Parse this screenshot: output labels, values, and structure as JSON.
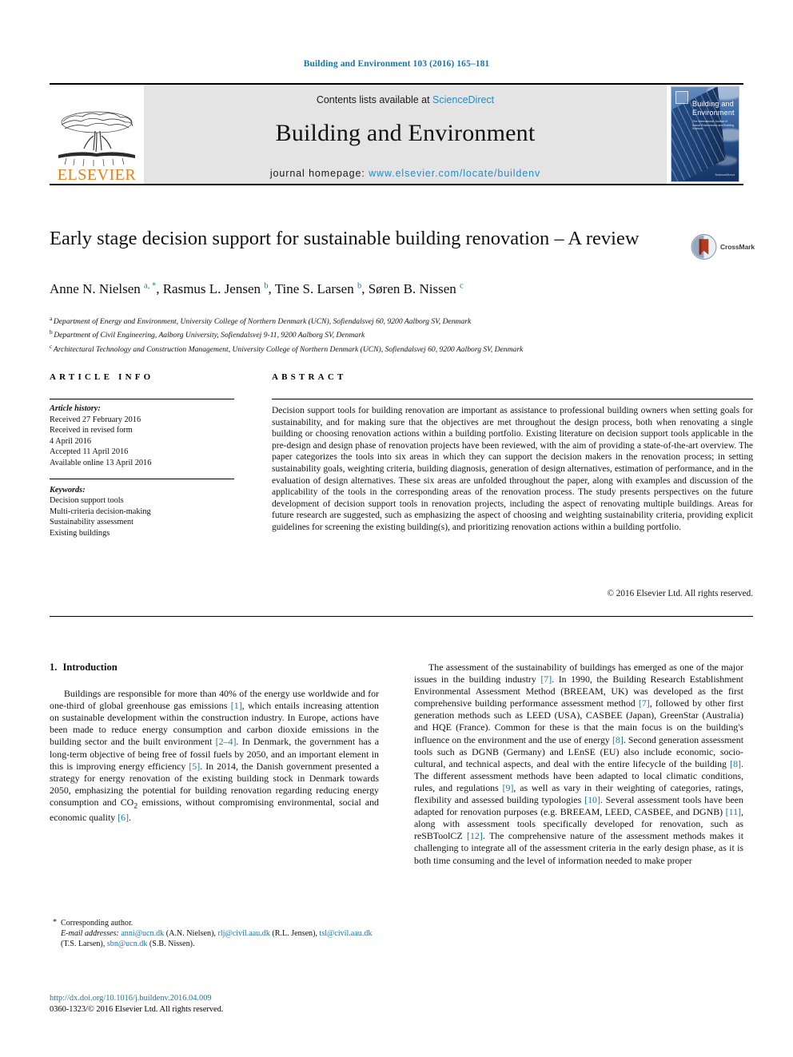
{
  "running_head": "Building and Environment 103 (2016) 165–181",
  "masthead": {
    "publisher_name": "ELSEVIER",
    "contents_prefix": "Contents lists available at ",
    "contents_link": "ScienceDirect",
    "journal_title": "Building and Environment",
    "homepage_label": "journal homepage: ",
    "homepage_url": "www.elsevier.com/locate/buildenv",
    "cover": {
      "title": "Building and Environment",
      "subtitle": "The International Journal of Indoor Environment and Building Science",
      "corner_text": "ScienceDirect"
    },
    "accent_blue": "#2b8bc4",
    "elsevier_orange": "#ef7d18"
  },
  "article": {
    "title": "Early stage decision support for sustainable building renovation – A review",
    "crossmark_label": "CrossMark",
    "authors_html": "Anne N. Nielsen <sup>a, *</sup>, Rasmus L. Jensen <sup>b</sup>, Tine S. Larsen <sup>b</sup>, Søren B. Nissen <sup>c</sup>",
    "affiliations": [
      {
        "marker": "a",
        "text": "Department of Energy and Environment, University College of Northern Denmark (UCN), Sofiendalsvej 60, 9200 Aalborg SV, Denmark"
      },
      {
        "marker": "b",
        "text": "Department of Civil Engineering, Aalborg University, Sofiendalsvej 9-11, 9200 Aalborg SV, Denmark"
      },
      {
        "marker": "c",
        "text": "Architectural Technology and Construction Management, University College of Northern Denmark (UCN), Sofiendalsvej 60, 9200 Aalborg SV, Denmark"
      }
    ]
  },
  "sections": {
    "article_info_header": "ARTICLE INFO",
    "abstract_header": "ABSTRACT"
  },
  "article_info": {
    "history_label": "Article history:",
    "history_lines": [
      "Received 27 February 2016",
      "Received in revised form",
      "4 April 2016",
      "Accepted 11 April 2016",
      "Available online 13 April 2016"
    ],
    "keywords_label": "Keywords:",
    "keywords": [
      "Decision support tools",
      "Multi-criteria decision-making",
      "Sustainability assessment",
      "Existing buildings"
    ]
  },
  "abstract": {
    "text": "Decision support tools for building renovation are important as assistance to professional building owners when setting goals for sustainability, and for making sure that the objectives are met throughout the design process, both when renovating a single building or choosing renovation actions within a building portfolio. Existing literature on decision support tools applicable in the pre-design and design phase of renovation projects have been reviewed, with the aim of providing a state-of-the-art overview. The paper categorizes the tools into six areas in which they can support the decision makers in the renovation process; in setting sustainability goals, weighting criteria, building diagnosis, generation of design alternatives, estimation of performance, and in the evaluation of design alternatives. These six areas are unfolded throughout the paper, along with examples and discussion of the applicability of the tools in the corresponding areas of the renovation process. The study presents perspectives on the future development of decision support tools in renovation projects, including the aspect of renovating multiple buildings. Areas for future research are suggested, such as emphasizing the aspect of choosing and weighting sustainability criteria, providing explicit guidelines for screening the existing building(s), and prioritizing renovation actions within a building portfolio.",
    "copyright": "© 2016 Elsevier Ltd. All rights reserved."
  },
  "body": {
    "intro_number": "1.",
    "intro_title": "Introduction",
    "left_paragraph_html": "Buildings are responsible for more than 40% of the energy use worldwide and for one-third of global greenhouse gas emissions <span class=\"cite\">[1]</span>, which entails increasing attention on sustainable development within the construction industry. In Europe, actions have been made to reduce energy consumption and carbon dioxide emissions in the building sector and the built environment <span class=\"cite\">[2–4]</span>. In Denmark, the government has a long-term objective of being free of fossil fuels by 2050, and an important element in this is improving energy efficiency <span class=\"cite\">[5]</span>. In 2014, the Danish government presented a strategy for energy renovation of the existing building stock in Denmark towards 2050, emphasizing the potential for building renovation regarding reducing energy consumption and CO<sub>2</sub> emissions, without compromising environmental, social and economic quality <span class=\"cite\">[6]</span>.",
    "right_paragraph_html": "The assessment of the sustainability of buildings has emerged as one of the major issues in the building industry <span class=\"cite\">[7]</span>. In 1990, the Building Research Establishment Environmental Assessment Method (BREEAM, UK) was developed as the first comprehensive building performance assessment method <span class=\"cite\">[7]</span>, followed by other first generation methods such as LEED (USA), CASBEE (Japan), GreenStar (Australia) and HQE (France). Common for these is that the main focus is on the building's influence on the environment and the use of energy <span class=\"cite\">[8]</span>. Second generation assessment tools such as DGNB (Germany) and LEnSE (EU) also include economic, socio-cultural, and technical aspects, and deal with the entire lifecycle of the building <span class=\"cite\">[8]</span>. The different assessment methods have been adapted to local climatic conditions, rules, and regulations <span class=\"cite\">[9]</span>, as well as vary in their weighting of categories, ratings, flexibility and assessed building typologies <span class=\"cite\">[10]</span>. Several assessment tools have been adapted for renovation purposes (e.g. BREEAM, LEED, CASBEE, and DGNB) <span class=\"cite\">[11]</span>, along with assessment tools specifically developed for renovation, such as reSBToolCZ <span class=\"cite\">[12]</span>. The comprehensive nature of the assessment methods makes it challenging to integrate all of the assessment criteria in the early design phase, as it is both time consuming and the level of information needed to make proper"
  },
  "footnotes": {
    "corresponding_star": "*",
    "corresponding_text": "Corresponding author.",
    "emails_label": "E-mail addresses:",
    "emails_html": "<span class=\"link\">anni@ucn.dk</span> (A.N. Nielsen), <span class=\"link\">rlj@civil.aau.dk</span> (R.L. Jensen), <span class=\"link\">tsl@civil.aau.dk</span> (T.S. Larsen), <span class=\"link\">sbn@ucn.dk</span> (S.B. Nissen).",
    "doi_url": "http://dx.doi.org/10.1016/j.buildenv.2016.04.009",
    "issn_line": "0360-1323/© 2016 Elsevier Ltd. All rights reserved."
  }
}
